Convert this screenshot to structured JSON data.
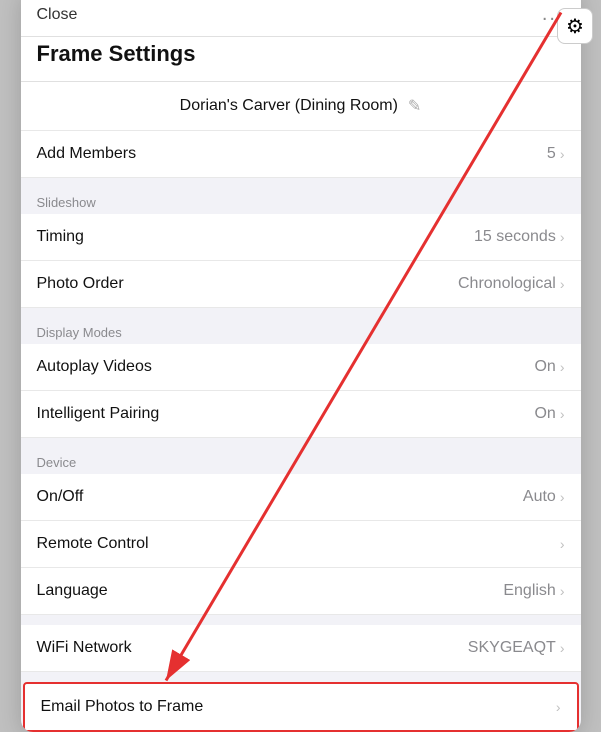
{
  "header": {
    "close_label": "Close",
    "more_label": "...",
    "title": "Frame Settings"
  },
  "frame": {
    "name": "Dorian's Carver (Dining Room)"
  },
  "add_members": {
    "label": "Add Members",
    "value": "5"
  },
  "slideshow_section": {
    "label": "Slideshow"
  },
  "slideshow_rows": [
    {
      "label": "Timing",
      "value": "15 seconds"
    },
    {
      "label": "Photo Order",
      "value": "Chronological"
    }
  ],
  "display_modes_section": {
    "label": "Display Modes"
  },
  "display_rows": [
    {
      "label": "Autoplay Videos",
      "value": "On"
    },
    {
      "label": "Intelligent Pairing",
      "value": "On"
    }
  ],
  "device_section": {
    "label": "Device"
  },
  "device_rows": [
    {
      "label": "On/Off",
      "value": "Auto"
    },
    {
      "label": "Remote Control",
      "value": ""
    },
    {
      "label": "Language",
      "value": "English"
    }
  ],
  "wifi_row": {
    "label": "WiFi Network",
    "value": "SKYGEAQT"
  },
  "email_row": {
    "label": "Email Photos to Frame",
    "value": ""
  },
  "gear_icon_label": "⚙",
  "icons": {
    "chevron": "›",
    "edit": "✎"
  }
}
